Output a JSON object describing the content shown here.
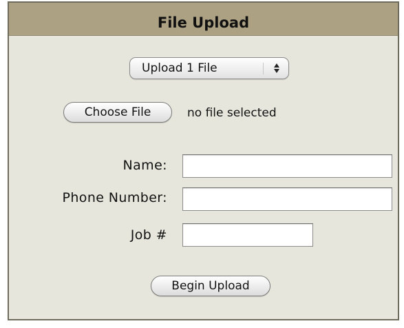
{
  "form": {
    "title": "File Upload",
    "upload_count_select": {
      "selected": "Upload 1 File"
    },
    "choose_file_label": "Choose File",
    "file_status": "no file selected",
    "fields": {
      "name_label": "Name:",
      "name_value": "",
      "phone_label": "Phone Number:",
      "phone_value": "",
      "job_label": "Job #",
      "job_value": ""
    },
    "submit_label": "Begin Upload"
  },
  "colors": {
    "title_bar": "#aca283",
    "panel_background": "#e7e6dc",
    "panel_border": "#6e6a5c"
  }
}
